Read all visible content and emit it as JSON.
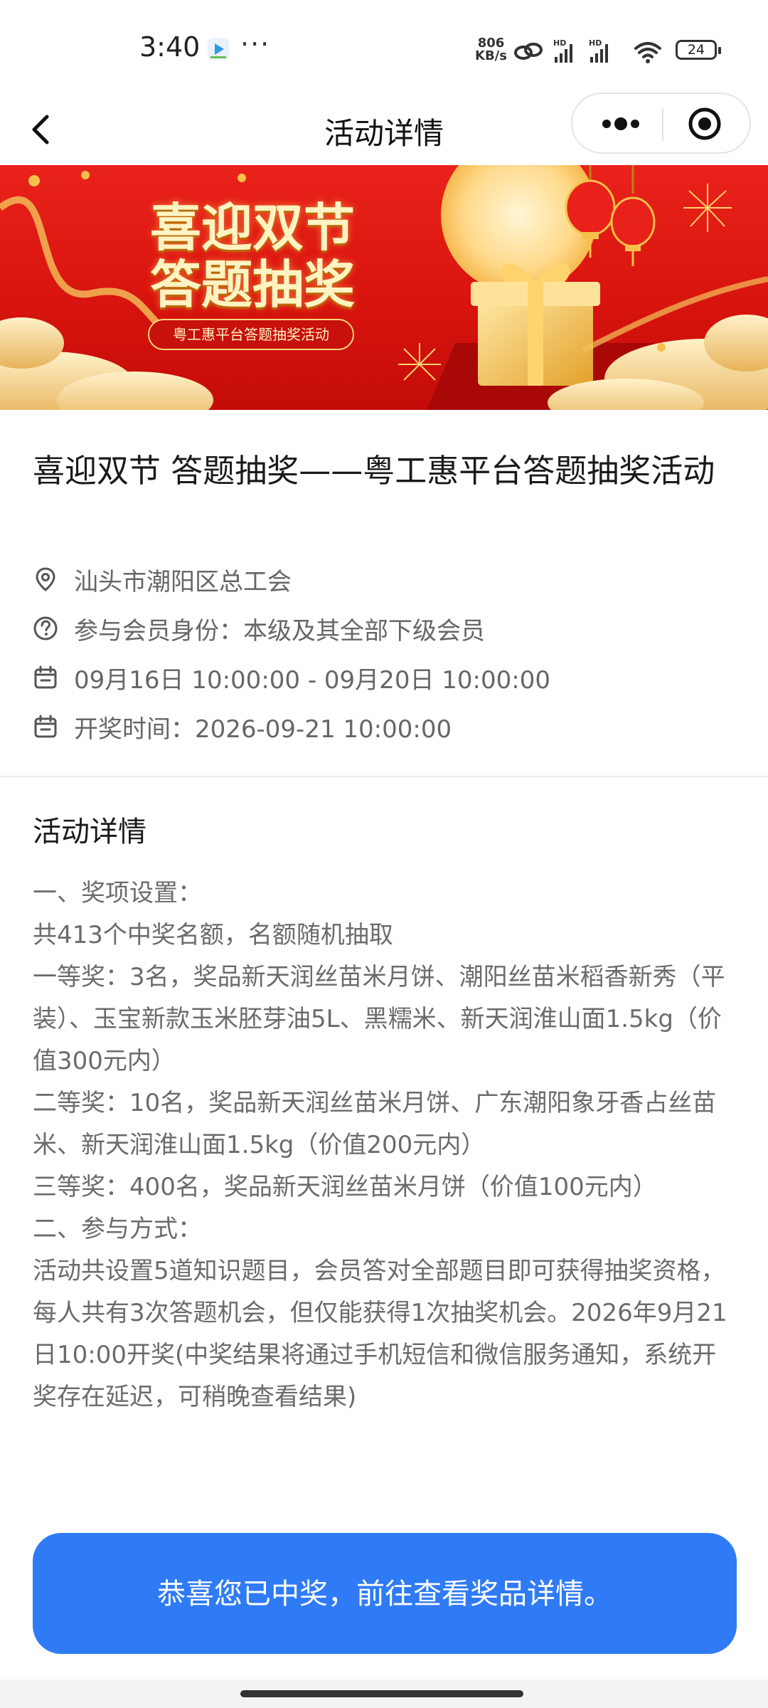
{
  "status_bar": {
    "time": "3:40",
    "speed_value": "806",
    "speed_unit": "KB/s",
    "battery": "24",
    "icons": [
      "video-app-icon",
      "more-dots",
      "hd-icon",
      "signal-icon",
      "wifi-icon",
      "battery-icon"
    ]
  },
  "nav": {
    "title": "活动详情",
    "back_icon": "back-chevron-icon",
    "more_icon": "more-icon",
    "close_icon": "target-close-icon"
  },
  "banner": {
    "title_line1": "喜迎双节",
    "title_line2": "答题抽奖",
    "subtitle": "粤工惠平台答题抽奖活动"
  },
  "activity": {
    "title": "喜迎双节 答题抽奖——粤工惠平台答题抽奖活动",
    "organizer": "汕头市潮阳区总工会",
    "eligibility": "参与会员身份：本级及其全部下级会员",
    "time_range": "09月16日 10:00:00 - 09月20日 10:00:00",
    "draw_time": "开奖时间：2026-09-21 10:00:00"
  },
  "details": {
    "heading": "活动详情",
    "paragraphs": [
      "一、奖项设置：",
      "共413个中奖名额，名额随机抽取",
      "一等奖：3名，奖品新天润丝苗米月饼、潮阳丝苗米稻香新秀（平装）、玉宝新款玉米胚芽油5L、黑糯米、新天润淮山面1.5kg（价值300元内）",
      "二等奖：10名，奖品新天润丝苗米月饼、广东潮阳象牙香占丝苗米、新天润淮山面1.5kg（价值200元内）",
      "三等奖：400名，奖品新天润丝苗米月饼（价值100元内）",
      "二、参与方式：",
      "活动共设置5道知识题目，会员答对全部题目即可获得抽奖资格，每人共有3次答题机会，但仅能获得1次抽奖机会。2026年9月21日10:00开奖(中奖结果将通过手机短信和微信服务通知，系统开奖存在延迟，可稍晚查看结果)"
    ]
  },
  "cta": {
    "label": "恭喜您已中奖，前往查看奖品详情。"
  },
  "colors": {
    "primary": "#2f7bf6",
    "banner_red": "#d8140e",
    "gold": "#f7d479",
    "muted_text": "#666666"
  }
}
